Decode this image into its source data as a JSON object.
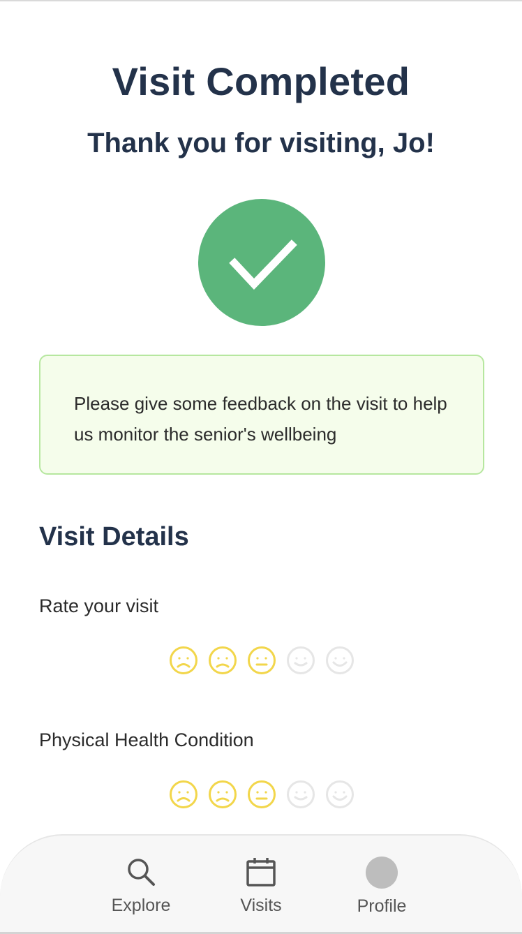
{
  "header": {
    "title": "Visit Completed",
    "subtitle": "Thank you for visiting, Jo!"
  },
  "status_icon": "check-circle-icon",
  "notice": {
    "text": "Please give some feedback on the visit to help us monitor the senior's wellbeing"
  },
  "details": {
    "section_title": "Visit Details",
    "fields": [
      {
        "label": "Rate your visit",
        "rating": 3,
        "max": 5
      },
      {
        "label": "Physical Health Condition",
        "rating": 3,
        "max": 5
      }
    ]
  },
  "nav": {
    "items": [
      {
        "label": "Explore",
        "icon": "search-icon"
      },
      {
        "label": "Visits",
        "icon": "calendar-icon"
      },
      {
        "label": "Profile",
        "icon": "avatar-icon"
      }
    ]
  },
  "colors": {
    "accent_green": "#5bb57b",
    "notice_bg": "#f5fdeb",
    "notice_border": "#b6e79f",
    "rating_active": "#f2d64b",
    "rating_inactive": "#e6e6e6",
    "heading": "#23324a"
  }
}
